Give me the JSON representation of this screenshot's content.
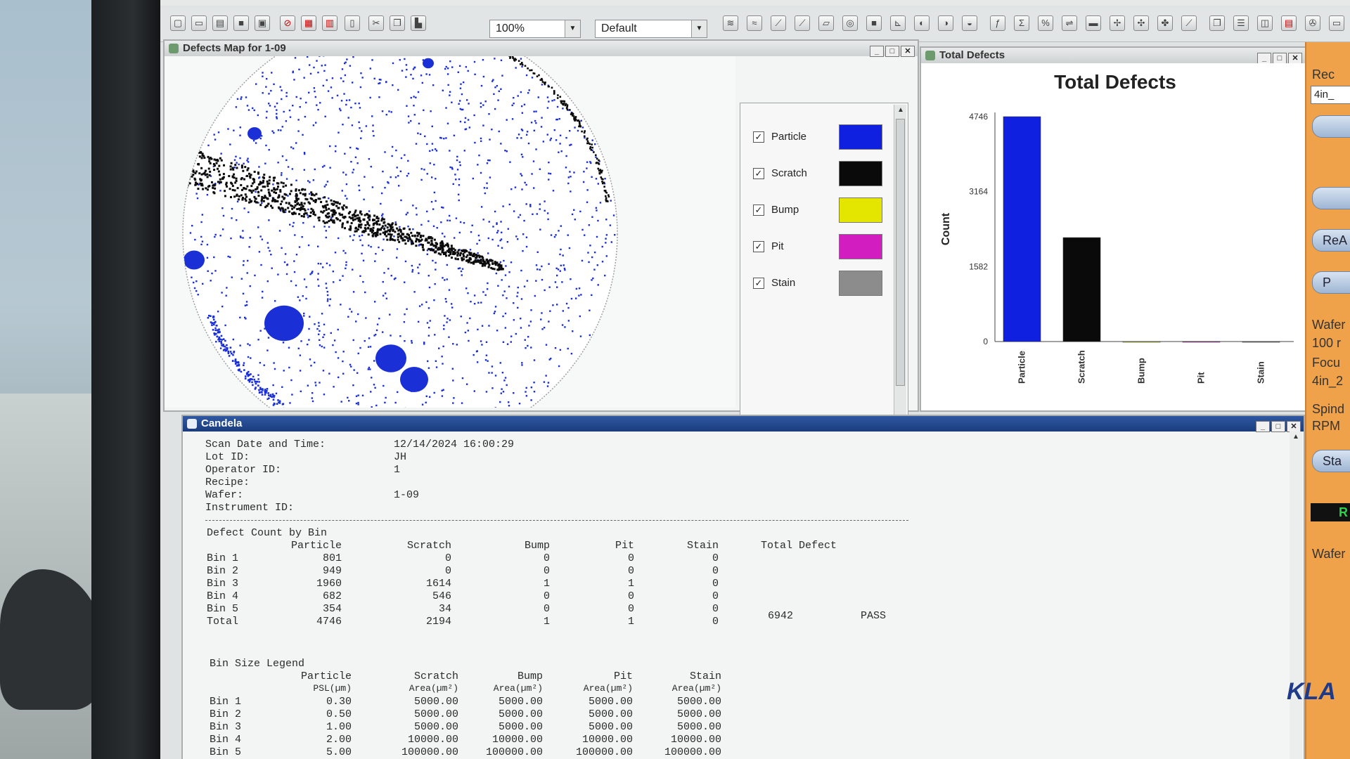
{
  "toolbar": {
    "zoom": "100%",
    "profile": "Default"
  },
  "wafer_window": {
    "title": "Defects Map for 1-09",
    "legend": [
      {
        "label": "Particle",
        "checked": true,
        "color": "#1020e0"
      },
      {
        "label": "Scratch",
        "checked": true,
        "color": "#0a0a0a"
      },
      {
        "label": "Bump",
        "checked": true,
        "color": "#e4e600"
      },
      {
        "label": "Pit",
        "checked": true,
        "color": "#d21ec0"
      },
      {
        "label": "Stain",
        "checked": true,
        "color": "#8c8c8c"
      }
    ]
  },
  "chart_window": {
    "title": "Total Defects"
  },
  "chart_data": {
    "type": "bar",
    "title": "Total Defects",
    "ylabel": "Count",
    "categories": [
      "Particle",
      "Scratch",
      "Bump",
      "Pit",
      "Stain"
    ],
    "values": [
      4746,
      2194,
      1,
      1,
      0
    ],
    "colors": [
      "#1020e0",
      "#0a0a0a",
      "#e4e600",
      "#d21ec0",
      "#8c8c8c"
    ],
    "yticks": [
      "0",
      "1582",
      "3164",
      "4746"
    ],
    "ylim": [
      0,
      4746
    ]
  },
  "report": {
    "title": "Candela",
    "header": [
      {
        "label": "Scan Date and Time:",
        "value": "12/14/2024 16:00:29"
      },
      {
        "label": "Lot ID:",
        "value": "JH"
      },
      {
        "label": "Operator ID:",
        "value": "1"
      },
      {
        "label": "Recipe:",
        "value": ""
      },
      {
        "label": "Wafer:",
        "value": "1-09"
      },
      {
        "label": "Instrument ID:",
        "value": ""
      }
    ],
    "defect_count_title": "Defect Count by Bin",
    "defect_cols": [
      "Particle",
      "Scratch",
      "Bump",
      "Pit",
      "Stain",
      "Total Defect"
    ],
    "defect_rows": [
      {
        "label": "Bin 1",
        "cells": [
          "801",
          "0",
          "0",
          "0",
          "0"
        ]
      },
      {
        "label": "Bin 2",
        "cells": [
          "949",
          "0",
          "0",
          "0",
          "0"
        ]
      },
      {
        "label": "Bin 3",
        "cells": [
          "1960",
          "1614",
          "1",
          "1",
          "0"
        ]
      },
      {
        "label": "Bin 4",
        "cells": [
          "682",
          "546",
          "0",
          "0",
          "0"
        ]
      },
      {
        "label": "Bin 5",
        "cells": [
          "354",
          "34",
          "0",
          "0",
          "0"
        ]
      },
      {
        "label": "Total",
        "cells": [
          "4746",
          "2194",
          "1",
          "1",
          "0"
        ],
        "total": "6942",
        "status": "PASS"
      }
    ],
    "bin_legend_title": "Bin Size Legend",
    "bin_cols": [
      "Particle",
      "Scratch",
      "Bump",
      "Pit",
      "Stain"
    ],
    "bin_units": [
      "PSL(µm)",
      "Area(µm²)",
      "Area(µm²)",
      "Area(µm²)",
      "Area(µm²)"
    ],
    "bin_rows": [
      {
        "label": "Bin 1",
        "cells": [
          "0.30",
          "5000.00",
          "5000.00",
          "5000.00",
          "5000.00"
        ]
      },
      {
        "label": "Bin 2",
        "cells": [
          "0.50",
          "5000.00",
          "5000.00",
          "5000.00",
          "5000.00"
        ]
      },
      {
        "label": "Bin 3",
        "cells": [
          "1.00",
          "5000.00",
          "5000.00",
          "5000.00",
          "5000.00"
        ]
      },
      {
        "label": "Bin 4",
        "cells": [
          "2.00",
          "10000.00",
          "10000.00",
          "10000.00",
          "10000.00"
        ]
      },
      {
        "label": "Bin 5",
        "cells": [
          "5.00",
          "100000.00",
          "100000.00",
          "100000.00",
          "100000.00"
        ]
      }
    ]
  },
  "side_panel": {
    "rec_label": "Rec",
    "rec_value": "4in_",
    "read_btn": "ReA",
    "p_btn": "P",
    "wafer_label": "Wafer",
    "wafer_value": "100 r",
    "focus_label": "Focu",
    "focus_value": "4in_2",
    "spin_label": "Spind",
    "rpm_label": "RPM",
    "start_btn": "Sta",
    "indicator": "R",
    "wafer2_label": "Wafer",
    "logo": "KLA"
  }
}
